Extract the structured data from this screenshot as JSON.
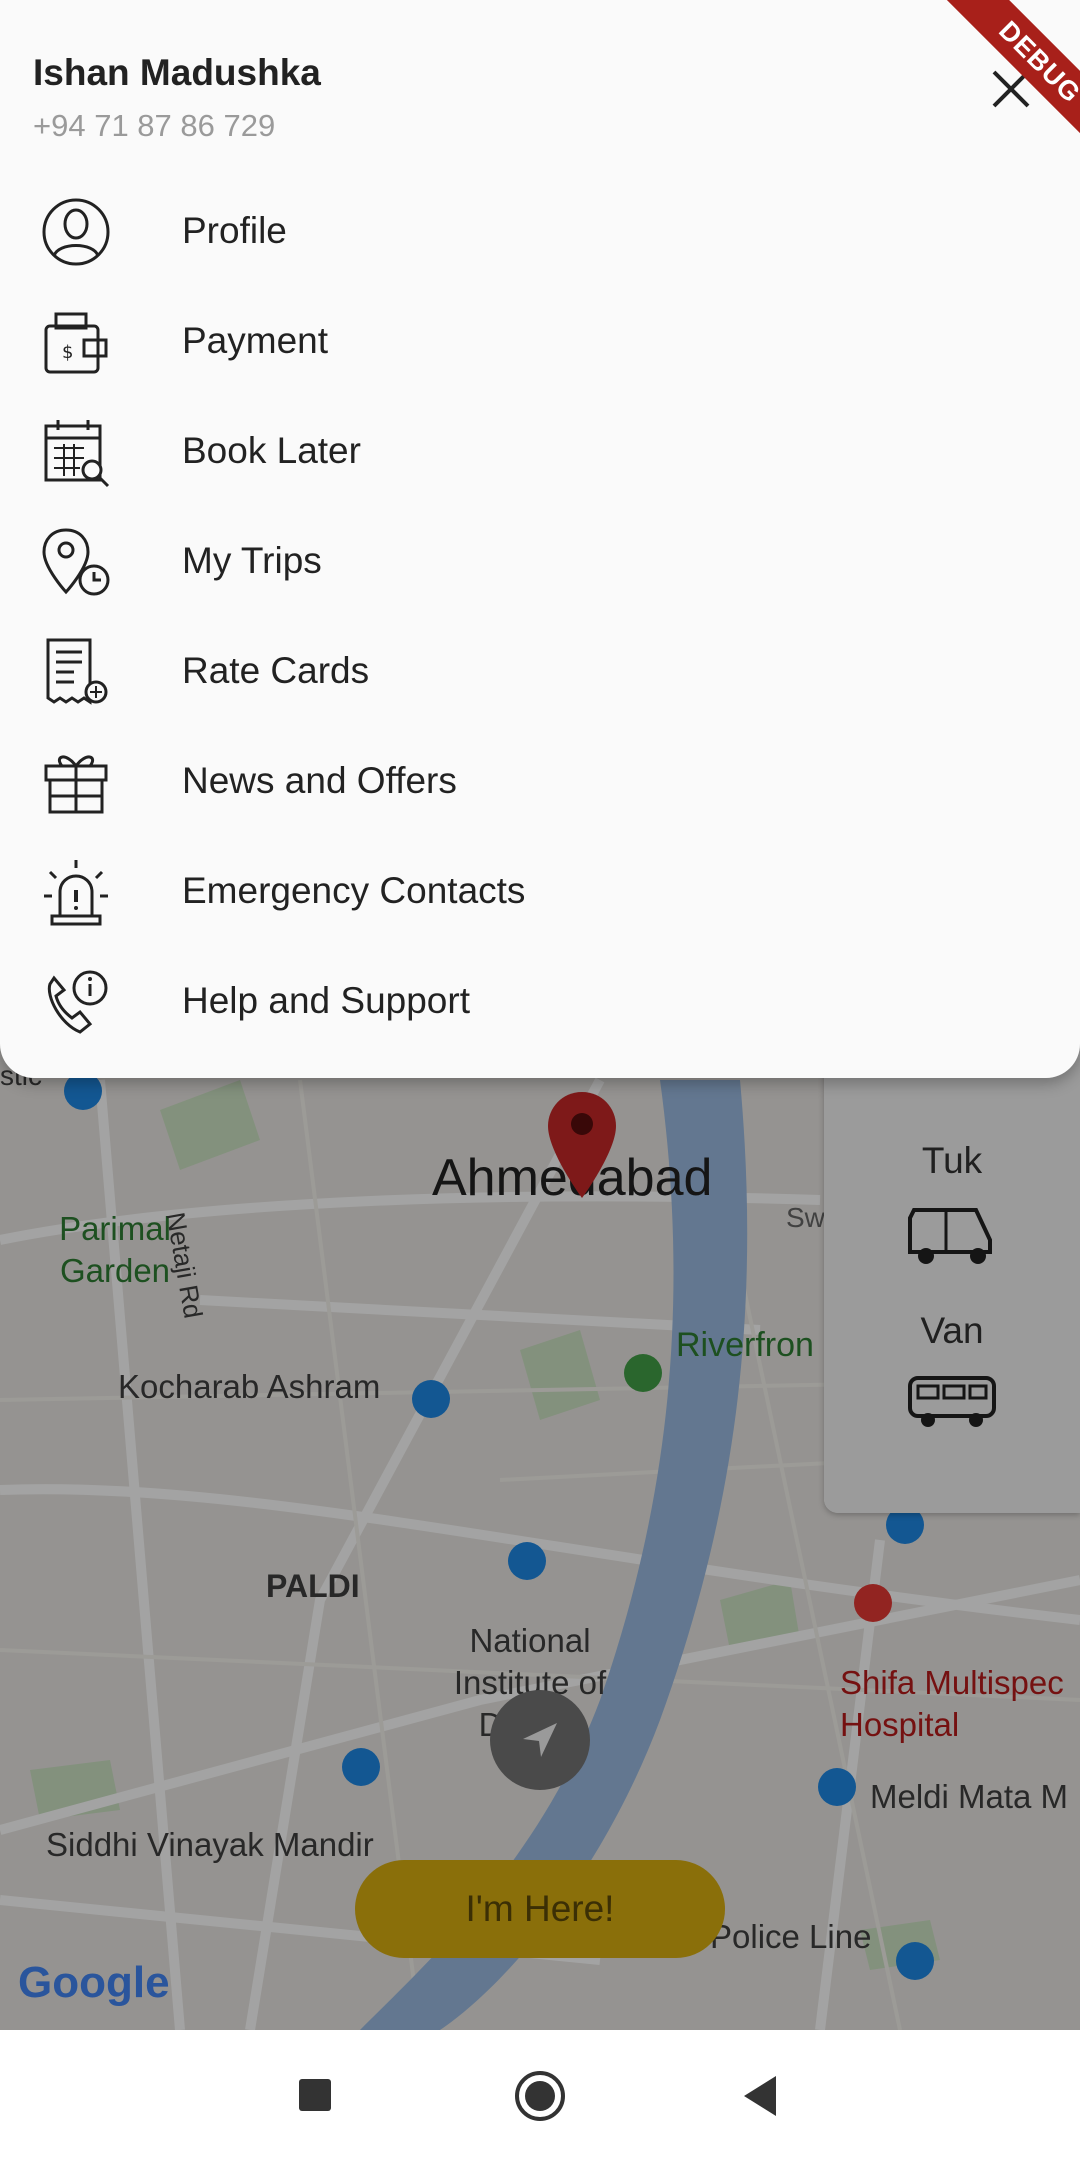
{
  "user": {
    "name": "Ishan Madushka",
    "phone": "+94 71 87 86 729"
  },
  "menu": [
    {
      "label": "Profile",
      "icon": "user-profile-icon"
    },
    {
      "label": "Payment",
      "icon": "wallet-icon"
    },
    {
      "label": "Book Later",
      "icon": "calendar-search-icon"
    },
    {
      "label": "My Trips",
      "icon": "location-clock-icon"
    },
    {
      "label": "Rate Cards",
      "icon": "receipt-icon"
    },
    {
      "label": "News and Offers",
      "icon": "gift-icon"
    },
    {
      "label": "Emergency Contacts",
      "icon": "siren-icon"
    },
    {
      "label": "Help and Support",
      "icon": "phone-info-icon"
    }
  ],
  "debug_banner": "DEBUG",
  "map": {
    "city_label": "Ahmedabad",
    "labels": {
      "parimal": "Parimal Garden",
      "netaji": "Netaji Rd",
      "riverfront": "Riverfron",
      "kocharab": "Kocharab Ashram",
      "paldi": "PALDI",
      "nid": "National Institute of Design",
      "shifa": "Shifa Multispec Hospital",
      "meldi": "Meldi Mata M",
      "siddhi": "Siddhi Vinayak Mandir",
      "police": "Police Line",
      "google": "Google",
      "stic": "stic",
      "sw": "Sw"
    }
  },
  "vehicles": [
    {
      "label": "Tuk",
      "icon": "tuk-tuk-icon"
    },
    {
      "label": "Van",
      "icon": "van-icon"
    }
  ],
  "action_button": "I'm Here!",
  "colors": {
    "river": "#9bbbe2",
    "pin": "#c62828",
    "button": "#f2c200",
    "ribbon": "#a8201a"
  }
}
